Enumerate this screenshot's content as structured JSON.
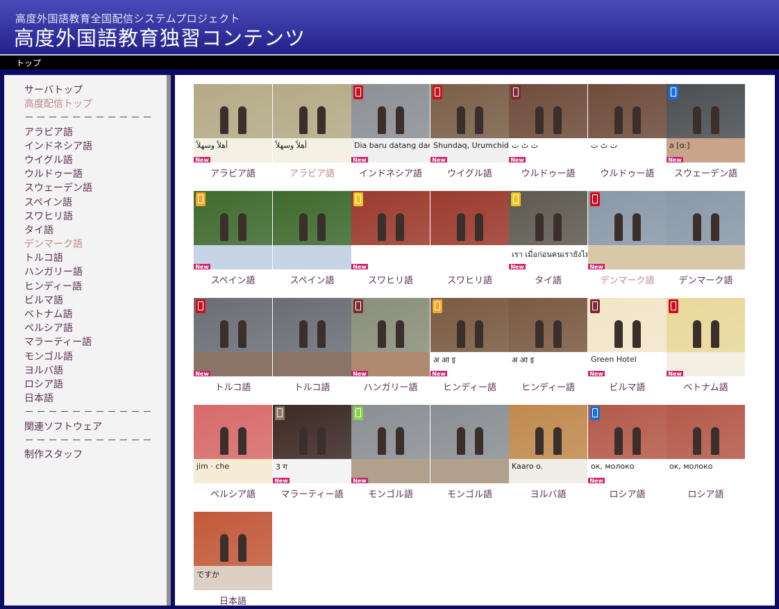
{
  "header": {
    "subtitle": "高度外国語教育全国配信システムプロジェクト",
    "title": "高度外国語教育独習コンテンツ"
  },
  "nav": {
    "top": "トップ"
  },
  "sidebar": {
    "items": [
      {
        "label": "サーバトップ",
        "kind": "link"
      },
      {
        "label": "高度配信トップ",
        "kind": "dim"
      },
      {
        "label": "－－－－－－－－－－－",
        "kind": "sep"
      },
      {
        "label": "アラビア語",
        "kind": "link"
      },
      {
        "label": "インドネシア語",
        "kind": "link"
      },
      {
        "label": "ウイグル語",
        "kind": "link"
      },
      {
        "label": "ウルドゥー語",
        "kind": "link"
      },
      {
        "label": "スウェーデン語",
        "kind": "link"
      },
      {
        "label": "スペイン語",
        "kind": "link"
      },
      {
        "label": "スワヒリ語",
        "kind": "link"
      },
      {
        "label": "タイ語",
        "kind": "link"
      },
      {
        "label": "デンマーク語",
        "kind": "dim"
      },
      {
        "label": "トルコ語",
        "kind": "link"
      },
      {
        "label": "ハンガリー語",
        "kind": "link"
      },
      {
        "label": "ヒンディー語",
        "kind": "link"
      },
      {
        "label": "ビルマ語",
        "kind": "link"
      },
      {
        "label": "ベトナム語",
        "kind": "link"
      },
      {
        "label": "ペルシア語",
        "kind": "link"
      },
      {
        "label": "マラーティー語",
        "kind": "link"
      },
      {
        "label": "モンゴル語",
        "kind": "link"
      },
      {
        "label": "ヨルバ語",
        "kind": "link"
      },
      {
        "label": "ロシア語",
        "kind": "link"
      },
      {
        "label": "日本語",
        "kind": "link"
      },
      {
        "label": "－－－－－－－－－－－",
        "kind": "sep"
      },
      {
        "label": "関連ソフトウェア",
        "kind": "link"
      },
      {
        "label": "－－－－－－－－－－－",
        "kind": "sep"
      },
      {
        "label": "制作スタッフ",
        "kind": "link"
      }
    ]
  },
  "badge_text": "New",
  "tiles": [
    {
      "label": "アラビア語",
      "new": true,
      "device": null,
      "scene": "#b4aa86",
      "lower": "#f4f0e4",
      "dim": false,
      "caption": "أهلاً وسهلاً"
    },
    {
      "label": "アラビア語",
      "new": false,
      "device": null,
      "scene": "#b4aa86",
      "lower": "#f4f0e4",
      "dim": true,
      "caption": "أهلاً وسهلاً"
    },
    {
      "label": "インドネシア語",
      "new": true,
      "device": "#c8101e",
      "scene": "#8c8f94",
      "lower": "#f0f0f0",
      "dim": false,
      "caption": "Dia baru datang dari Osaka"
    },
    {
      "label": "ウイグル語",
      "new": true,
      "device": "#c8101e",
      "scene": "#7a5f48",
      "lower": "#f0f0f0",
      "dim": false,
      "caption": "Shundaq, Urumchide"
    },
    {
      "label": "ウルドゥー語",
      "new": true,
      "device": "#7d2a35",
      "scene": "#6e4c3a",
      "lower": "#ffffff",
      "dim": false,
      "caption": "ث ٹ ت"
    },
    {
      "label": "ウルドゥー語",
      "new": false,
      "device": null,
      "scene": "#6e4c3a",
      "lower": "#ffffff",
      "dim": false,
      "caption": "ث ٹ ت"
    },
    {
      "label": "スウェーデン語",
      "new": true,
      "device": "#1a6fd6",
      "scene": "#4c4f52",
      "lower": "#c9a48a",
      "dim": false,
      "caption": "a [ɑː]"
    },
    {
      "label": "スペイン語",
      "new": true,
      "device": "#f0a824",
      "scene": "#3f6a2e",
      "lower": "#c6d4e6",
      "dim": false,
      "caption": ""
    },
    {
      "label": "スペイン語",
      "new": false,
      "device": null,
      "scene": "#3f6a2e",
      "lower": "#c6d4e6",
      "dim": false,
      "caption": ""
    },
    {
      "label": "スワヒリ語",
      "new": true,
      "device": "#f0c41e",
      "scene": "#9c3a2e",
      "lower": "#ffffff",
      "dim": false,
      "caption": ""
    },
    {
      "label": "スワヒリ語",
      "new": false,
      "device": null,
      "scene": "#9c3a2e",
      "lower": "#ffffff",
      "dim": false,
      "caption": ""
    },
    {
      "label": "タイ語",
      "new": true,
      "device": "#f0c41e",
      "scene": "#5e5a50",
      "lower": "#ffffff",
      "dim": false,
      "caption": "เรา เมื่อก่อนคนเรายังไม่"
    },
    {
      "label": "デンマーク語",
      "new": true,
      "device": "#c8101e",
      "scene": "#8a98a8",
      "lower": "#d8c8a8",
      "dim": true,
      "caption": ""
    },
    {
      "label": "デンマーク語",
      "new": false,
      "device": null,
      "scene": "#8a98a8",
      "lower": "#d8c8a8",
      "dim": false,
      "caption": ""
    },
    {
      "label": "トルコ語",
      "new": true,
      "device": "#c8101e",
      "scene": "#6a6e74",
      "lower": "#8a7466",
      "dim": false,
      "caption": ""
    },
    {
      "label": "トルコ語",
      "new": false,
      "device": null,
      "scene": "#6a6e74",
      "lower": "#8a7466",
      "dim": false,
      "caption": ""
    },
    {
      "label": "ハンガリー語",
      "new": true,
      "device": "#7d2a35",
      "scene": "#8a8f7a",
      "lower": "#b08a6e",
      "dim": false,
      "caption": ""
    },
    {
      "label": "ヒンディー語",
      "new": true,
      "device": "#f0a824",
      "scene": "#7a5a42",
      "lower": "#ffffff",
      "dim": false,
      "caption": "अ आ इ"
    },
    {
      "label": "ヒンディー語",
      "new": false,
      "device": null,
      "scene": "#7a5a42",
      "lower": "#ffffff",
      "dim": false,
      "caption": "अ आ इ"
    },
    {
      "label": "ビルマ語",
      "new": true,
      "device": "#7d2a35",
      "scene": "#f2e6c8",
      "lower": "#ffffff",
      "dim": false,
      "caption": "Green Hotel"
    },
    {
      "label": "ベトナム語",
      "new": true,
      "device": "#c8101e",
      "scene": "#e8d89a",
      "lower": "#f2efe2",
      "dim": false,
      "caption": ""
    },
    {
      "label": "ペルシア語",
      "new": false,
      "device": null,
      "scene": "#d86a6a",
      "lower": "#f6ecd6",
      "dim": false,
      "caption": "jim · che"
    },
    {
      "label": "マラーティー語",
      "new": true,
      "device": "#8a7766",
      "scene": "#3c2a24",
      "lower": "#f4f4f4",
      "dim": false,
      "caption": "3 ग"
    },
    {
      "label": "モンゴル語",
      "new": true,
      "device": "#8ad048",
      "scene": "#8a8f94",
      "lower": "#b0a08c",
      "dim": false,
      "caption": ""
    },
    {
      "label": "モンゴル語",
      "new": false,
      "device": null,
      "scene": "#8a8f94",
      "lower": "#b0a08c",
      "dim": false,
      "caption": ""
    },
    {
      "label": "ヨルバ語",
      "new": false,
      "device": null,
      "scene": "#c08a4e",
      "lower": "#f0ece6",
      "dim": false,
      "caption": "Kaaro o."
    },
    {
      "label": "ロシア語",
      "new": true,
      "device": "#1a6fd6",
      "scene": "#b45a4a",
      "lower": "#ffffff",
      "dim": false,
      "caption": "ок, молоко"
    },
    {
      "label": "ロシア語",
      "new": false,
      "device": null,
      "scene": "#b45a4a",
      "lower": "#ffffff",
      "dim": false,
      "caption": "ок, молоко"
    },
    {
      "label": "日本語",
      "new": false,
      "device": null,
      "scene": "#c25a3a",
      "lower": "#dcd0c4",
      "dim": false,
      "caption": "ですか"
    }
  ]
}
